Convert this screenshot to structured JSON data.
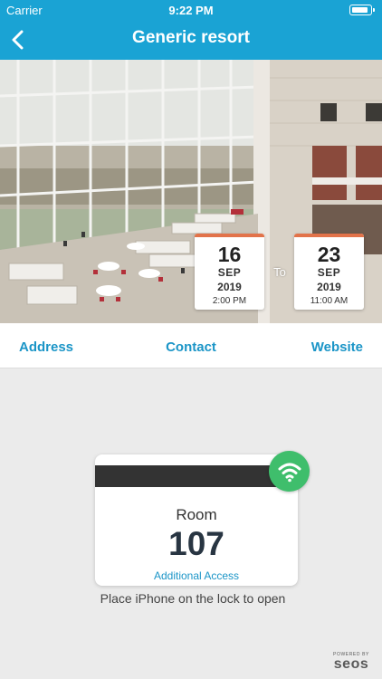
{
  "status_bar": {
    "carrier": "Carrier",
    "time": "9:22 PM",
    "battery_icon": "battery-icon"
  },
  "nav": {
    "title": "Generic resort",
    "back_icon": "chevron-left-icon"
  },
  "stay": {
    "check_in": {
      "day": "16",
      "month": "SEP",
      "year": "2019",
      "time": "2:00 PM"
    },
    "separator": "To",
    "check_out": {
      "day": "23",
      "month": "SEP",
      "year": "2019",
      "time": "11:00 AM"
    }
  },
  "links": {
    "address": "Address",
    "contact": "Contact",
    "website": "Website"
  },
  "key": {
    "room_label": "Room",
    "room_number": "107",
    "additional_access": "Additional Access",
    "status_icon": "wifi-icon",
    "hint": "Place iPhone on the lock to open"
  },
  "footer": {
    "powered_by": "POWERED BY",
    "brand": "seos"
  },
  "colors": {
    "primary": "#1aa3d4",
    "link": "#1b95c7",
    "date_accent": "#e2734a",
    "wifi_badge": "#3fbe6c",
    "background": "#ebebeb"
  }
}
